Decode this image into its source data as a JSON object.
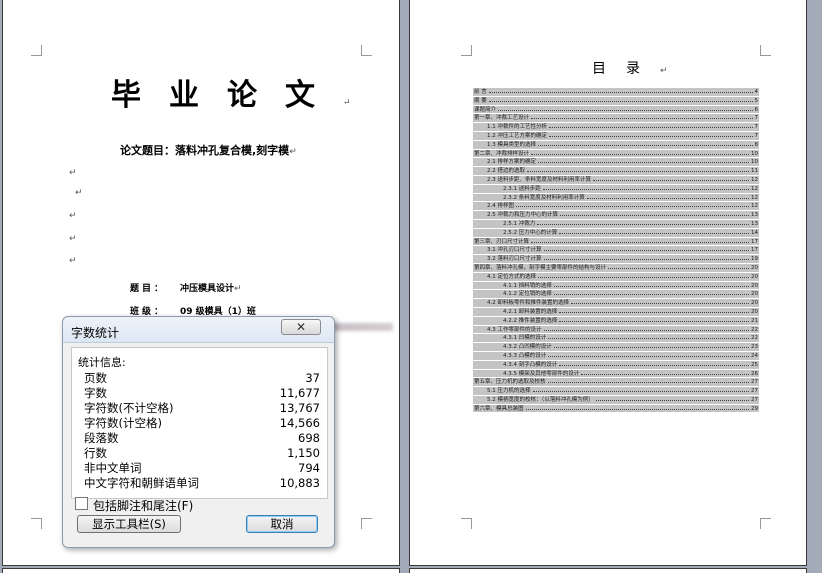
{
  "cover": {
    "title": "毕业论文",
    "subject": "论文题目：落料冲孔复合模,刻字模",
    "topic_label": "题目：",
    "topic_value": "冲压模具设计",
    "class_label": "班级：",
    "class_value": "09 级模具（1）班",
    "return_mark": "↵",
    "blank_marks": [
      "↵",
      "↵",
      "↵",
      "↵",
      "↵"
    ]
  },
  "toc": {
    "title": "目录",
    "entries": [
      {
        "text": "前    言",
        "page": "4",
        "level": 0
      },
      {
        "text": "摘    要",
        "page": "5",
        "level": 0
      },
      {
        "text": "课题简介",
        "page": "6",
        "level": 0
      },
      {
        "text": "第一章、冲裁工艺设计",
        "page": "7",
        "level": 0
      },
      {
        "text": "1.1 冲裁件的工艺性分析",
        "page": "7",
        "level": 1
      },
      {
        "text": "1.2 冲压工艺方案的确定",
        "page": "7",
        "level": 1
      },
      {
        "text": "1.3 模具类型的选择",
        "page": "8",
        "level": 1
      },
      {
        "text": "第二章、冲裁排样设计",
        "page": "10",
        "level": 0
      },
      {
        "text": "2.1 排样方案的确定",
        "page": "10",
        "level": 1
      },
      {
        "text": "2.2 搭边的选取",
        "page": "11",
        "level": 1
      },
      {
        "text": "2.3 送料步距、条料宽度及材料利用率计算",
        "page": "12",
        "level": 1
      },
      {
        "text": "2.3.1 送料步距",
        "page": "12",
        "level": 2
      },
      {
        "text": "2.3.2 条料宽度及材料利用率计算",
        "page": "12",
        "level": 2
      },
      {
        "text": "2.4 排样图",
        "page": "12",
        "level": 1
      },
      {
        "text": "2.5 冲裁力和压力中心的计算",
        "page": "13",
        "level": 1
      },
      {
        "text": "2.5.1 冲裁力",
        "page": "13",
        "level": 2
      },
      {
        "text": "2.5.2 压力中心的计算",
        "page": "14",
        "level": 2
      },
      {
        "text": "第三章、刃口尺寸计算",
        "page": "17",
        "level": 0
      },
      {
        "text": "3.1 冲孔刃口尺寸计算",
        "page": "17",
        "level": 1
      },
      {
        "text": "3.2 落料刃口尺寸计算",
        "page": "19",
        "level": 1
      },
      {
        "text": "第四章、落料冲孔模，刻字模主要零部件的结构与设计",
        "page": "20",
        "level": 0
      },
      {
        "text": "4.1 定位方式的选择",
        "page": "20",
        "level": 1
      },
      {
        "text": "4.1.1 挡料销的选择",
        "page": "20",
        "level": 2
      },
      {
        "text": "4.1.2 定位销的选择",
        "page": "20",
        "level": 2
      },
      {
        "text": "4.2 卸料板零件和推件装置的选择",
        "page": "20",
        "level": 1
      },
      {
        "text": "4.2.1 卸料装置的选择",
        "page": "20",
        "level": 2
      },
      {
        "text": "4.2.2 推件装置的选择",
        "page": "21",
        "level": 2
      },
      {
        "text": "4.3 工作零部件的设计",
        "page": "22",
        "level": 1
      },
      {
        "text": "4.3.1 凹模的设计",
        "page": "22",
        "level": 2
      },
      {
        "text": "4.3.2 凸凹模的设计",
        "page": "23",
        "level": 2
      },
      {
        "text": "4.3.3 凸模的设计",
        "page": "24",
        "level": 2
      },
      {
        "text": "4.3.4 刻字凸模的设计",
        "page": "25",
        "level": 2
      },
      {
        "text": "4.3.5 模架及其他零部件的设计",
        "page": "26",
        "level": 2
      },
      {
        "text": "第五章、压力机的选取及校核",
        "page": "27",
        "level": 0
      },
      {
        "text": "5.1 压力机的选择",
        "page": "27",
        "level": 1
      },
      {
        "text": "5.2 模柄宽度的校核：（以落料冲孔模为例）",
        "page": "27",
        "level": 1
      },
      {
        "text": "第六章、模具总装图",
        "page": "29",
        "level": 0
      }
    ]
  },
  "dialog": {
    "title": "字数统计",
    "close_label": "✕",
    "group_label": "统计信息:",
    "stats": [
      {
        "name": "页数",
        "value": "37"
      },
      {
        "name": "字数",
        "value": "11,677"
      },
      {
        "name": "字符数(不计空格)",
        "value": "13,767"
      },
      {
        "name": "字符数(计空格)",
        "value": "14,566"
      },
      {
        "name": "段落数",
        "value": "698"
      },
      {
        "name": "行数",
        "value": "1,150"
      },
      {
        "name": "非中文单词",
        "value": "794"
      },
      {
        "name": "中文字符和朝鲜语单词",
        "value": "10,883"
      }
    ],
    "checkbox_label": "包括脚注和尾注(F)",
    "checkbox_checked": false,
    "toolbar_button": "显示工具栏(S)",
    "cancel_button": "取消"
  }
}
